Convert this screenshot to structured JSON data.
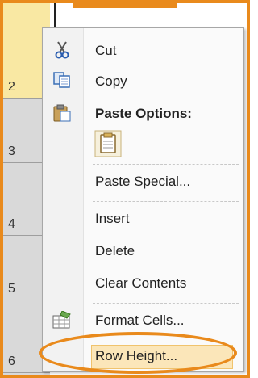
{
  "row_headers": [
    "2",
    "3",
    "4",
    "5",
    "6"
  ],
  "menu": {
    "cut": "Cut",
    "copy": "Copy",
    "paste_options": "Paste Options:",
    "paste_special": "Paste Special...",
    "insert": "Insert",
    "delete": "Delete",
    "clear_contents": "Clear Contents",
    "format_cells": "Format Cells...",
    "row_height": "Row Height..."
  },
  "icons": {
    "cut": "scissors-icon",
    "copy": "copy-icon",
    "paste_options": "clipboard-icon",
    "paste": "paste-icon",
    "format_cells": "format-cells-icon"
  },
  "colors": {
    "highlight_orange": "#E98A1C",
    "selected_row": "#f9e8a3",
    "row_header_bg": "#d9d9d9"
  }
}
